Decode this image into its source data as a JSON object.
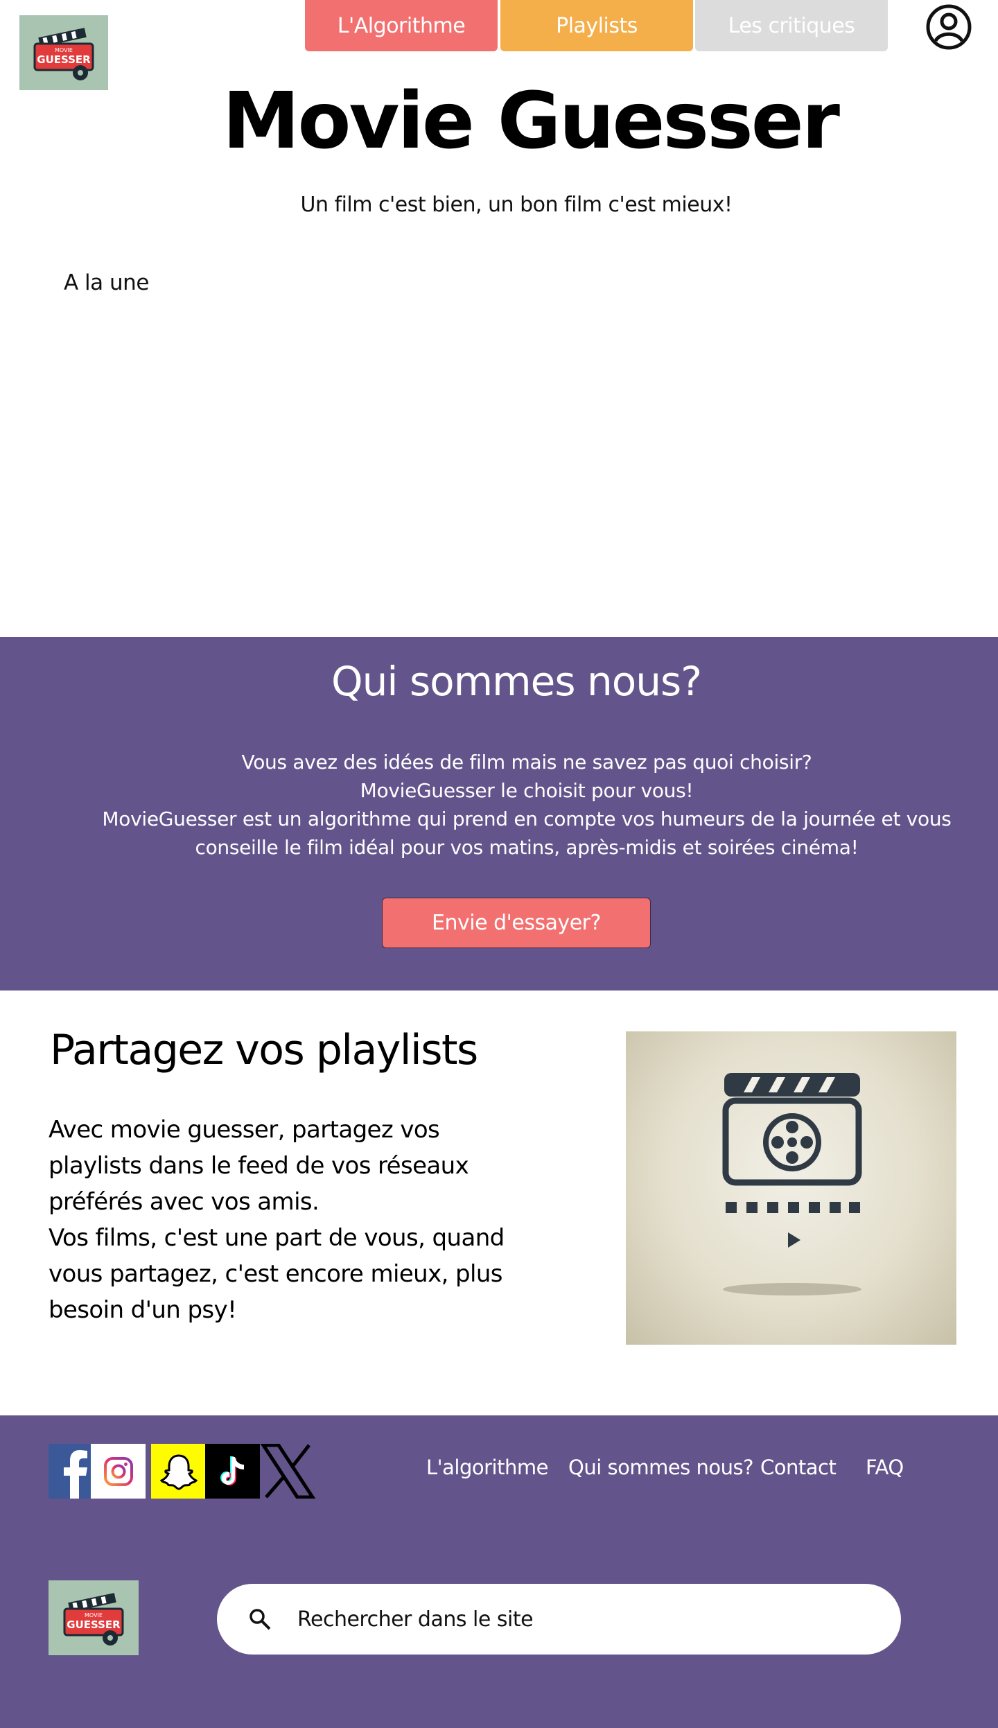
{
  "header": {
    "logo_text_top": "MOVIE",
    "logo_text_main": "GUESSER",
    "nav": [
      {
        "label": "L'Algorithme",
        "color": "#f37070"
      },
      {
        "label": "Playlists",
        "color": "#f4ae4a"
      },
      {
        "label": "Les critiques",
        "color": "#dcdcdc"
      }
    ],
    "title": "Movie Guesser",
    "tagline": "Un film c'est bien, un bon film c'est mieux!",
    "featured_label": "A la une"
  },
  "about": {
    "title": "Qui sommes nous?",
    "lines": [
      "Vous avez des idées de film mais ne savez pas quoi choisir?",
      "MovieGuesser le choisit pour vous!",
      "MovieGuesser est un algorithme qui prend en compte vos humeurs de la journée et vous conseille le film idéal pour vos matins, après-midis et soirées cinéma!"
    ],
    "button_label": "Envie d'essayer?",
    "background": "#63558c"
  },
  "playlists": {
    "title": "Partagez vos playlists",
    "paragraphs": [
      "Avec movie guesser, partagez vos playlists dans le feed de vos réseaux préférés avec vos amis.",
      "Vos films, c'est une part de vous, quand vous partagez, c'est encore mieux, plus besoin d'un psy!"
    ]
  },
  "footer": {
    "social": [
      "facebook-icon",
      "instagram-icon",
      "snapchat-icon",
      "tiktok-icon",
      "x-icon"
    ],
    "links": [
      "L'algorithme",
      "Qui sommes nous?",
      "Contact",
      "FAQ"
    ],
    "search_placeholder": "Rechercher dans le site"
  }
}
